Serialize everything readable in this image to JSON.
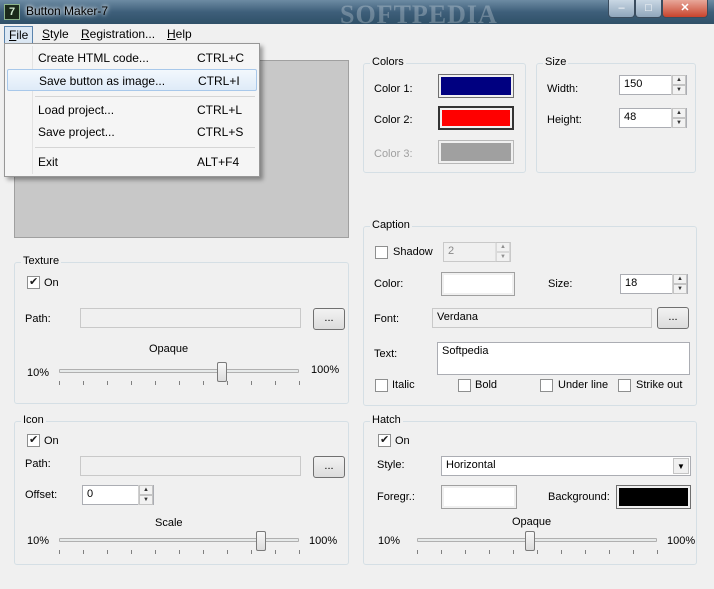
{
  "window": {
    "title": "Button Maker-7",
    "icon_glyph": "7",
    "watermark": "SOFTPEDIA",
    "controls": {
      "minimize": "–",
      "maximize": "□",
      "close": "✕"
    }
  },
  "menubar": {
    "file": "File",
    "style": "Style",
    "registration": "Registration...",
    "help": "Help"
  },
  "file_menu": [
    {
      "label": "Create HTML code...",
      "shortcut": "CTRL+C"
    },
    {
      "label": "Save button as image...",
      "shortcut": "CTRL+I"
    },
    {
      "label": "Load project...",
      "shortcut": "CTRL+L"
    },
    {
      "label": "Save project...",
      "shortcut": "CTRL+S"
    },
    {
      "label": "Exit",
      "shortcut": "ALT+F4"
    }
  ],
  "texture": {
    "legend": "Texture",
    "on_label": "On",
    "on_checked": true,
    "path_label": "Path:",
    "path_value": "",
    "browse": "...",
    "slider_caption": "Opaque",
    "min": "10%",
    "max": "100%",
    "slider_value": 0.68
  },
  "icon": {
    "legend": "Icon",
    "on_label": "On",
    "on_checked": true,
    "path_label": "Path:",
    "path_value": "",
    "browse": "...",
    "offset_label": "Offset:",
    "offset_value": "0",
    "slider_caption": "Scale",
    "min": "10%",
    "max": "100%",
    "slider_value": 0.84
  },
  "colors": {
    "legend": "Colors",
    "color1_label": "Color 1:",
    "color1": "#000080",
    "color2_label": "Color 2:",
    "color2": "#ff0000",
    "color3_label": "Color 3:",
    "color3": "#a0a0a0"
  },
  "size": {
    "legend": "Size",
    "width_label": "Width:",
    "width_value": "150",
    "height_label": "Height:",
    "height_value": "48"
  },
  "caption": {
    "legend": "Caption",
    "shadow_label": "Shadow",
    "shadow_checked": false,
    "shadow_value": "2",
    "color_label": "Color:",
    "color": "#ffffff",
    "size_label": "Size:",
    "size_value": "18",
    "font_label": "Font:",
    "font_value": "Verdana",
    "font_browse": "...",
    "text_label": "Text:",
    "text_value": "Softpedia",
    "bold": "Bold",
    "italic": "Italic",
    "underline": "Under line",
    "strike": "Strike out"
  },
  "hatch": {
    "legend": "Hatch",
    "on_label": "On",
    "on_checked": true,
    "style_label": "Style:",
    "style_value": "Horizontal",
    "foreground_label": "Foregr.:",
    "foreground": "#ffffff",
    "background_label": "Background:",
    "background": "#000000",
    "slider_caption": "Opaque",
    "min": "10%",
    "max": "100%",
    "slider_value": 0.47
  }
}
